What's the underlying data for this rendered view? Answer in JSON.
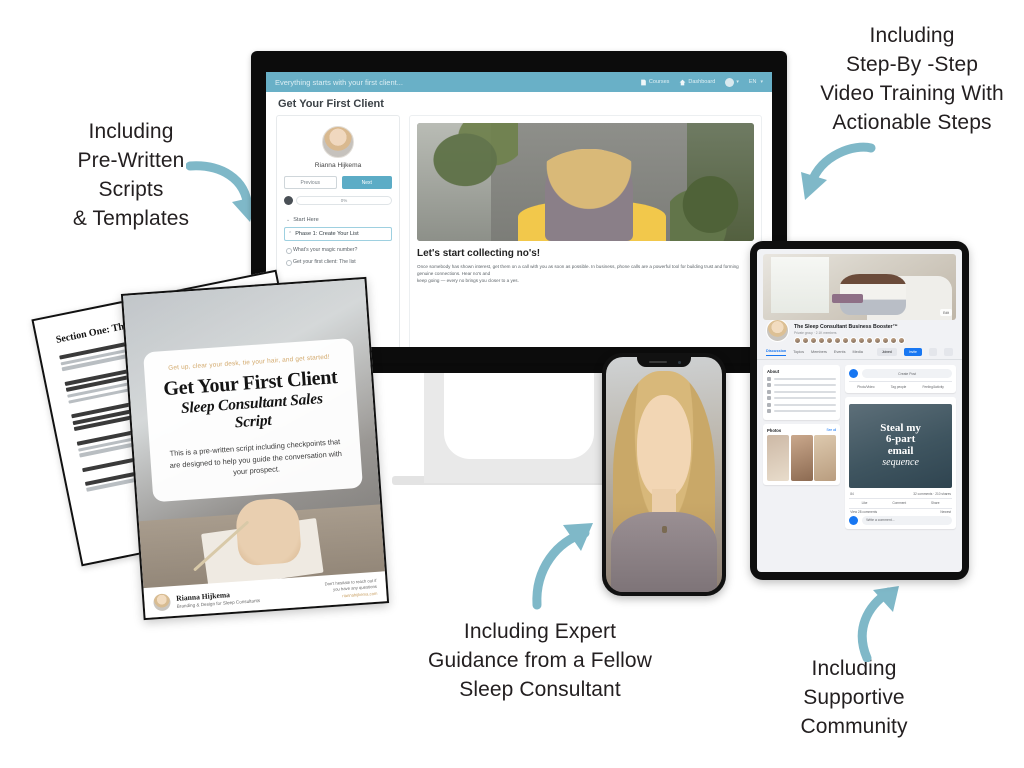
{
  "callouts": {
    "scripts": "Including\nPre-Written\nScripts\n& Templates",
    "video": "Including\nStep-By -Step\nVideo Training With\nActionable Steps",
    "guidance": "Including Expert\nGuidance from a Fellow\nSleep Consultant",
    "community": "Including\nSupportive\nCommunity"
  },
  "colors": {
    "arrow": "#7fb8c8",
    "app_header": "#69b0c7",
    "app_accent": "#5cacc6",
    "facebook_blue": "#1877f2",
    "text": "#231f20"
  },
  "desktop": {
    "topbar": {
      "tagline": "Everything starts with your first client...",
      "courses_label": "Courses",
      "dashboard_label": "Dashboard",
      "language_label": "EN"
    },
    "page_title": "Get Your First Client",
    "sidebar": {
      "instructor_name": "Rianna Hijkema",
      "previous_label": "Previous",
      "next_label": "Next",
      "progress_value": "0%",
      "sections": [
        {
          "label": "Start Here",
          "active": false
        },
        {
          "label": "Phase 1: Create Your List",
          "active": true
        }
      ],
      "lessons": [
        "What's your magic number?",
        "Get your first client: The list"
      ]
    },
    "lesson": {
      "title": "Let's start collecting no's!",
      "paragraph_1": "Once somebody has shown interest, get them on a call with you as soon as possible. In business, phone calls are a powerful tool for building trust and forming genuine connections. Hear no's and",
      "paragraph_2": "keep going — every no brings you closer to a yes."
    }
  },
  "tablet": {
    "group_name": "The Sleep Consultant Business Booster™",
    "group_meta": "Private group · 2.1K members",
    "cover_edit_label": "Edit",
    "tabs": [
      "Discussion",
      "Topics",
      "Members",
      "Events",
      "Media",
      "More"
    ],
    "join_label": "Joined",
    "invite_label": "Invite",
    "about_heading": "About",
    "composer_placeholder": "Create Post",
    "composer_actions": [
      "Photo/Video",
      "Tag people",
      "Feeling/Activity"
    ],
    "post_image_lines": [
      "Steal my",
      "6-part",
      "email",
      "sequence"
    ],
    "post_reactions": "84",
    "post_stats": "32 comments  ·  210 shares",
    "post_bar": [
      "Like",
      "Comment",
      "Share"
    ],
    "comments_label": "View 28 comments",
    "comments_sort": "Newest",
    "comment_placeholder": "Write a comment...",
    "photos_heading": "Photos",
    "photos_seeall": "See all"
  },
  "phone": {
    "content_description": "Video of instructor speaking"
  },
  "script_cover": {
    "kicker": "Get up, clear your desk, tie your hair, and get started!",
    "title": "Get Your First Client",
    "subtitle": "Sleep Consultant Sales Script",
    "description": "This is a pre-written script including checkpoints that are designed to help you guide the conversation with your prospect.",
    "author_name": "Rianna Hijkema",
    "author_role": "Branding & Design for Sleep Consultants",
    "contact_note": "Don't hesitate to reach out if\nyou have any questions",
    "contact_link": "riannahijkema.com"
  },
  "script_page": {
    "heading": "Section One: The"
  }
}
